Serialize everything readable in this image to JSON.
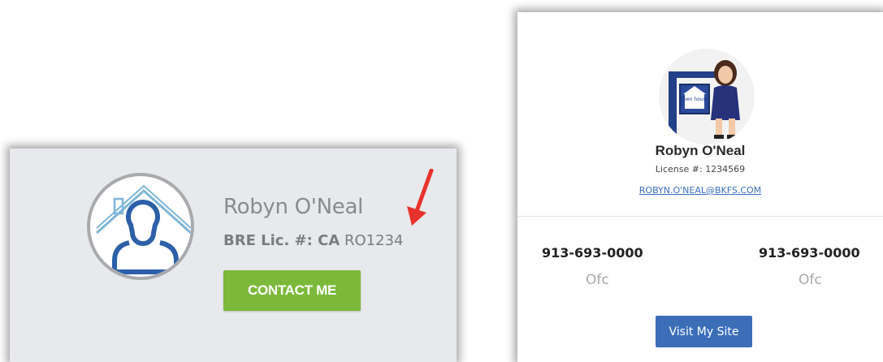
{
  "left_card": {
    "agent_name": "Robyn O'Neal",
    "license_label": "BRE Lic. #: CA",
    "license_number": "RO1234",
    "contact_button": "CONTACT ME"
  },
  "right_card": {
    "agent_name": "Robyn O'Neal",
    "license_label": "License #:",
    "license_number": "1234569",
    "email": "ROBYN.O'NEAL@BKFS.COM",
    "phones": [
      {
        "number": "913-693-0000",
        "label": "Ofc"
      },
      {
        "number": "913-693-0000",
        "label": "Ofc"
      }
    ],
    "visit_button": "Visit My Site",
    "sign_text": "open house"
  },
  "colors": {
    "contact_button": "#7cb93a",
    "visit_button": "#3c6eb8",
    "email_link": "#3b6fbf",
    "arrow": "#e8322b",
    "house_icon_blue": "#2d5fa8",
    "house_roof_light": "#7fb6d9"
  },
  "icons": {
    "left_avatar": "house-person-icon",
    "annotation": "red-arrow-icon",
    "right_avatar": "agent-photo"
  }
}
